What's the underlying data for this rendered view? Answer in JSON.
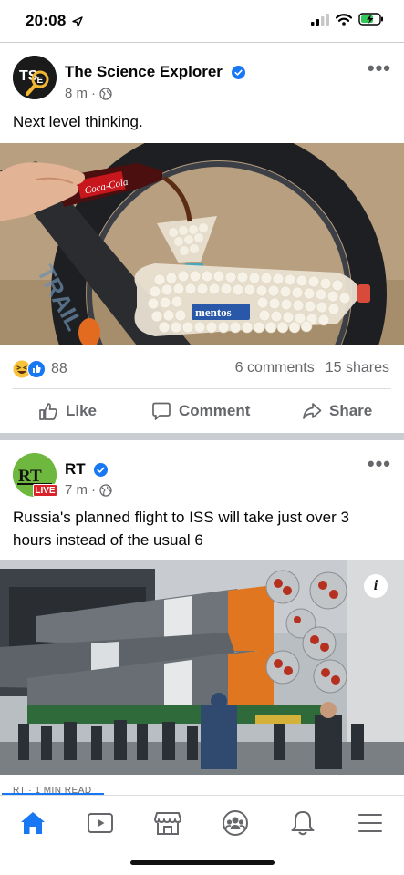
{
  "status_bar": {
    "time": "20:08"
  },
  "posts": [
    {
      "author": "The Science Explorer",
      "time": "8 m",
      "text": "Next level thinking.",
      "image_label": "mentos",
      "reaction_count": "88",
      "comments": "6 comments",
      "shares": "15 shares",
      "avatar_text": "TSE"
    },
    {
      "author": "RT",
      "time": "7 m",
      "text": "Russia's planned flight to ISS will take just over 3 hours instead of the usual 6",
      "avatar_text": "RT",
      "live_badge": "LIVE",
      "info_glyph": "i",
      "read_hint": "RT · 1 MIN READ"
    }
  ],
  "actions": {
    "like": "Like",
    "comment": "Comment",
    "share": "Share"
  },
  "tabs": [
    "home-icon",
    "video-icon",
    "marketplace-icon",
    "groups-icon",
    "notifications-icon",
    "menu-icon"
  ],
  "colors": {
    "brand_blue": "#1877f2",
    "gray_text": "#65676b",
    "rt_green": "#6fb83f",
    "live_red": "#d8232a"
  }
}
